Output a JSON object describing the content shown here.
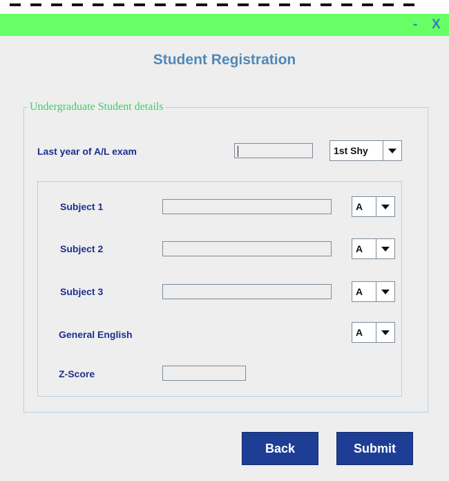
{
  "window": {
    "minimize_label": "-",
    "close_label": "X",
    "titlebar_color": "#66ff66"
  },
  "page": {
    "title": "Student Registration"
  },
  "group": {
    "legend": "Undergraduate Student details"
  },
  "exam": {
    "label": "Last year of A/L exam",
    "year_value": "",
    "attempt_selected": "1st Shy"
  },
  "subjects": [
    {
      "label": "Subject 1",
      "value": "",
      "grade": "A"
    },
    {
      "label": "Subject 2",
      "value": "",
      "grade": "A"
    },
    {
      "label": "Subject 3",
      "value": "",
      "grade": "A"
    }
  ],
  "english": {
    "label": "General English",
    "grade": "A"
  },
  "zscore": {
    "label": "Z-Score",
    "value": ""
  },
  "actions": {
    "back_label": "Back",
    "submit_label": "Submit",
    "button_color": "#1e3e96"
  },
  "icons": {
    "dropdown": "chevron-down-icon",
    "minimize": "minimize-icon",
    "close": "close-icon"
  }
}
